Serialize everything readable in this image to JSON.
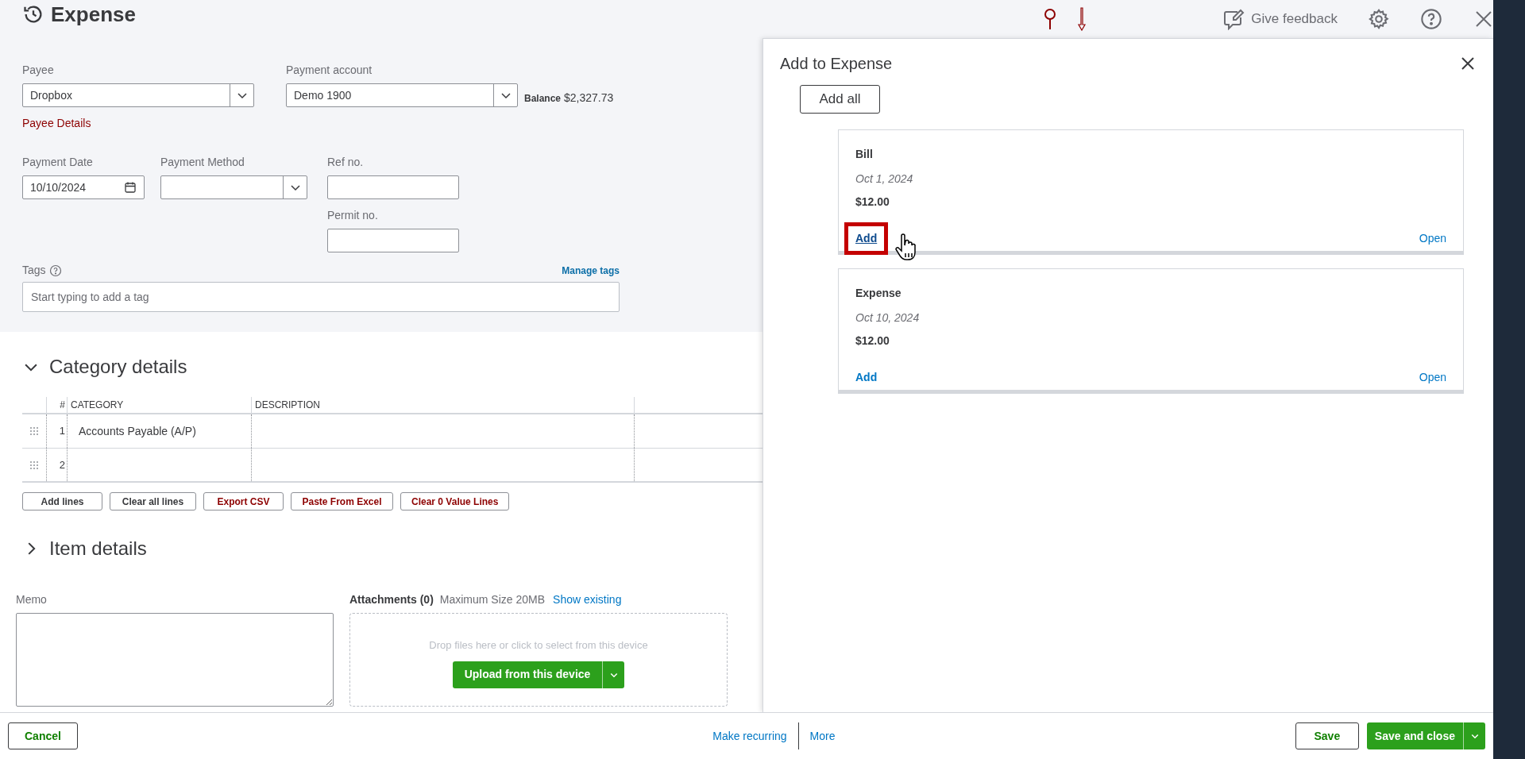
{
  "header": {
    "title": "Expense",
    "feedback": "Give feedback"
  },
  "payee": {
    "label": "Payee",
    "value": "Dropbox",
    "details_link": "Payee Details"
  },
  "payment_account": {
    "label": "Payment account",
    "value": "Demo 1900",
    "balance_label": "Balance",
    "balance": "$2,327.73"
  },
  "payment_date": {
    "label": "Payment Date",
    "value": "10/10/2024"
  },
  "payment_method": {
    "label": "Payment Method"
  },
  "ref_no": {
    "label": "Ref no."
  },
  "permit_no": {
    "label": "Permit no."
  },
  "tags": {
    "label": "Tags",
    "manage_link": "Manage tags",
    "placeholder": "Start typing to add a tag"
  },
  "category_section": {
    "title": "Category details",
    "expanded": true
  },
  "table": {
    "columns": [
      "#",
      "CATEGORY",
      "DESCRIPTION"
    ],
    "rows": [
      {
        "number": "1",
        "category": "Accounts Payable (A/P)"
      },
      {
        "number": "2",
        "category": ""
      }
    ]
  },
  "table_buttons": [
    {
      "label": "Add lines",
      "kind": "plain"
    },
    {
      "label": "Clear all lines",
      "kind": "plain"
    },
    {
      "label": "Export CSV",
      "kind": "accent"
    },
    {
      "label": "Paste From Excel",
      "kind": "accent"
    },
    {
      "label": "Clear 0 Value Lines",
      "kind": "accent"
    }
  ],
  "item_section": {
    "title": "Item details",
    "expanded": false
  },
  "memo": {
    "label": "Memo"
  },
  "attachments": {
    "label": "Attachments (0)",
    "max_size": "Maximum Size 20MB",
    "show_link": "Show existing",
    "drop_hint": "Drop files here or click to select from this device",
    "upload_button": "Upload from this device"
  },
  "panel": {
    "title": "Add to Expense",
    "add_all": "Add all",
    "cards": [
      {
        "type": "Bill",
        "date": "Oct 1, 2024",
        "amount": "$12.00",
        "add": "Add",
        "open": "Open",
        "highlighted": true
      },
      {
        "type": "Expense",
        "date": "Oct 10, 2024",
        "amount": "$12.00",
        "add": "Add",
        "open": "Open",
        "highlighted": false
      }
    ]
  },
  "footer": {
    "cancel": "Cancel",
    "make_recurring": "Make recurring",
    "more": "More",
    "save": "Save",
    "save_and_close": "Save and close"
  }
}
